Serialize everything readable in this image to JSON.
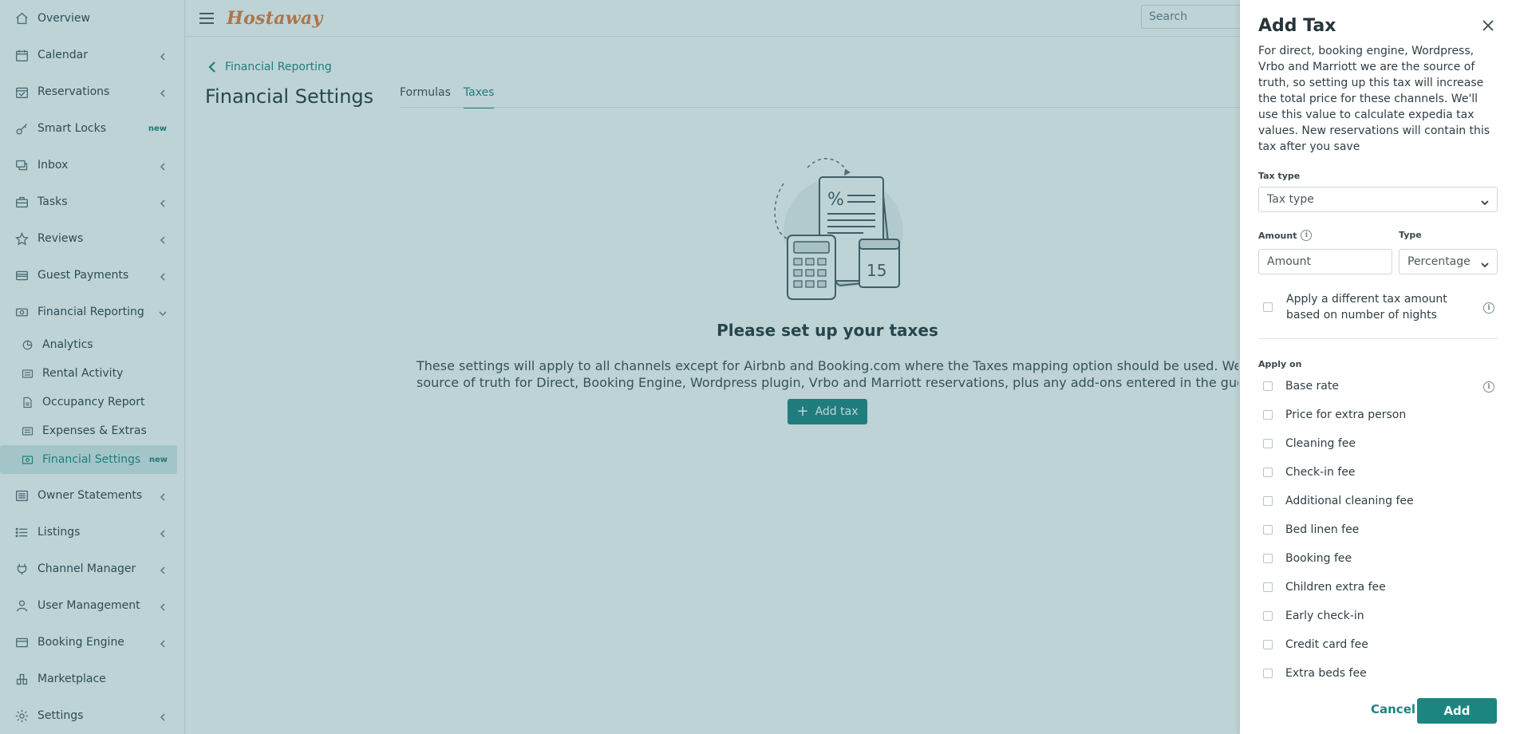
{
  "sidebar": {
    "items": [
      {
        "label": "Overview",
        "icon": "home-icon",
        "chevron": false
      },
      {
        "label": "Calendar",
        "icon": "calendar-icon",
        "chevron": true
      },
      {
        "label": "Reservations",
        "icon": "calendar-check-icon",
        "chevron": true
      },
      {
        "label": "Smart Locks",
        "icon": "key-icon",
        "badge": "new"
      },
      {
        "label": "Inbox",
        "icon": "chat-icon",
        "chevron": true
      },
      {
        "label": "Tasks",
        "icon": "briefcase-icon",
        "chevron": true
      },
      {
        "label": "Reviews",
        "icon": "star-icon",
        "chevron": true
      },
      {
        "label": "Guest Payments",
        "icon": "credit-card-icon",
        "chevron": true
      },
      {
        "label": "Financial Reporting",
        "icon": "money-icon",
        "expanded": true
      }
    ],
    "sub_items": [
      {
        "label": "Analytics",
        "icon": "pie-chart-icon"
      },
      {
        "label": "Rental Activity",
        "icon": "list-icon"
      },
      {
        "label": "Occupancy Report",
        "icon": "document-icon"
      },
      {
        "label": "Expenses & Extras",
        "icon": "list-icon"
      },
      {
        "label": "Financial Settings",
        "icon": "settings-doc-icon",
        "badge": "new",
        "active": true
      }
    ],
    "bottom_items": [
      {
        "label": "Owner Statements",
        "icon": "statement-icon",
        "chevron": true
      },
      {
        "label": "Listings",
        "icon": "listings-icon",
        "chevron": true
      },
      {
        "label": "Channel Manager",
        "icon": "plug-icon",
        "chevron": true
      },
      {
        "label": "User Management",
        "icon": "user-icon",
        "chevron": true
      },
      {
        "label": "Booking Engine",
        "icon": "booking-icon",
        "chevron": true
      },
      {
        "label": "Marketplace",
        "icon": "marketplace-icon",
        "chevron": false
      },
      {
        "label": "Settings",
        "icon": "gear-icon",
        "chevron": true
      }
    ]
  },
  "topbar": {
    "logo": "Hostaway",
    "search_placeholder": "Search"
  },
  "page": {
    "breadcrumb": "Financial Reporting",
    "title": "Financial Settings",
    "tabs": [
      {
        "label": "Formulas",
        "active": false
      },
      {
        "label": "Taxes",
        "active": true
      }
    ],
    "empty_title": "Please set up your taxes",
    "empty_desc_line1": "These settings will apply to all channels except for Airbnb and Booking.com where the Taxes mapping option should be used. We'll be",
    "empty_desc_line2": "source of truth for Direct, Booking Engine, Wordpress plugin, Vrbo and Marriott reservations, plus any add-ons entered in the guest po",
    "add_tax_label": "Add tax",
    "illustration_day": "15"
  },
  "drawer": {
    "title": "Add Tax",
    "description": "For direct, booking engine, Wordpress, Vrbo and Marriott we are the source of truth, so setting up this tax will increase the total price for these channels. We'll use this value to calculate expedia tax values. New reservations will contain this tax after you save",
    "tax_type_label": "Tax type",
    "tax_type_placeholder": "Tax type",
    "amount_label": "Amount",
    "amount_placeholder": "Amount",
    "type_label": "Type",
    "type_value": "Percentage",
    "nights_option": "Apply a different tax amount based on number of nights",
    "apply_on_label": "Apply on",
    "apply_on_options": [
      "Base rate",
      "Price for extra person",
      "Cleaning fee",
      "Check-in fee",
      "Additional cleaning fee",
      "Bed linen fee",
      "Booking fee",
      "Children extra fee",
      "Early check-in",
      "Credit card fee",
      "Extra beds fee"
    ],
    "cancel_label": "Cancel",
    "add_label": "Add"
  }
}
